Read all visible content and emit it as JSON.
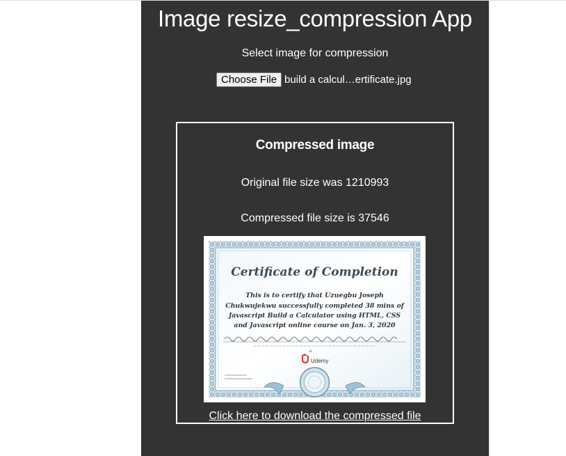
{
  "app": {
    "title": "Image resize_compression App",
    "select_label": "Select image for compression",
    "choose_file_label": "Choose File",
    "selected_file_name": "build a calcul…ertificate.jpg"
  },
  "result": {
    "heading": "Compressed image",
    "original_size_text": "Original file size was 1210993",
    "compressed_size_text": "Compressed file size is 37546",
    "download_link_text": "Click here to download the compressed file"
  },
  "certificate": {
    "title": "Certificate of Completion",
    "body_lines": [
      "This is to certify that Uzuegbu Joseph",
      "Chukwujekwu successfully completed 38 mins of",
      "Javascript Build a Calculator using HTML, CSS",
      "and Javascript online course on Jan. 3, 2020"
    ],
    "brand": "Udemy",
    "colors": {
      "border": "#7fa9bd",
      "title": "#3d4a57",
      "text": "#2e3740"
    }
  },
  "colors": {
    "panel_background": "#333333",
    "page_background": "#ffffff",
    "text": "#ffffff"
  }
}
